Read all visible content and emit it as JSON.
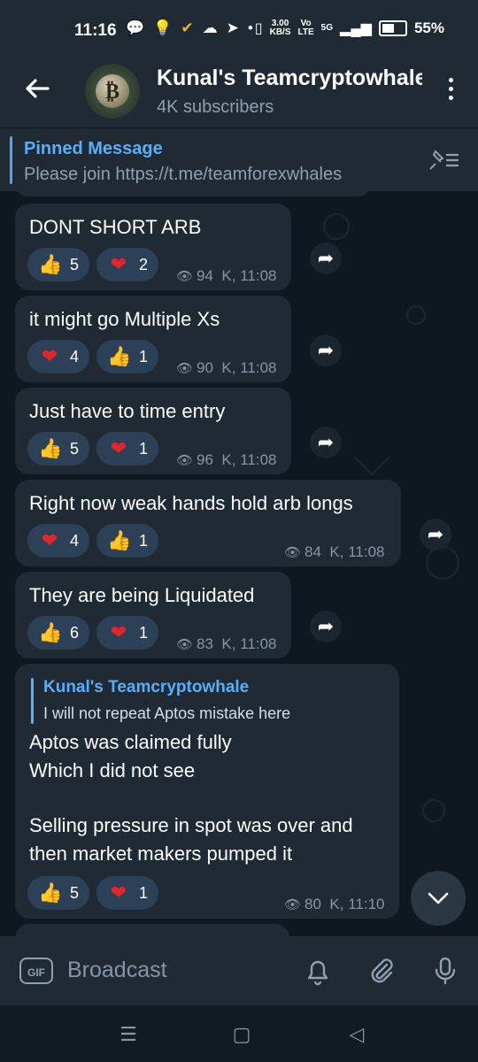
{
  "status_bar": {
    "time": "11:16",
    "speed_value": "3.00",
    "speed_unit": "KB/S",
    "network": "5G",
    "battery": "55%"
  },
  "header": {
    "channel_name": "Kunal's Teamcryptowhale",
    "subscribers": "4K subscribers"
  },
  "pinned": {
    "title": "Pinned Message",
    "text": "Please join   https://t.me/teamforexwhales"
  },
  "messages": [
    {
      "text": "DONT SHORT ARB",
      "reactions": [
        {
          "emoji": "👍",
          "count": "5"
        },
        {
          "emoji": "❤",
          "count": "2"
        }
      ],
      "views": "94",
      "time": "K, 11:08"
    },
    {
      "text": "it might go Multiple Xs",
      "reactions": [
        {
          "emoji": "❤",
          "count": "4"
        },
        {
          "emoji": "👍",
          "count": "1"
        }
      ],
      "views": "90",
      "time": "K, 11:08"
    },
    {
      "text": "Just have to time entry",
      "reactions": [
        {
          "emoji": "👍",
          "count": "5"
        },
        {
          "emoji": "❤",
          "count": "1"
        }
      ],
      "views": "96",
      "time": "K, 11:08"
    },
    {
      "text": "Right now weak hands hold arb longs",
      "reactions": [
        {
          "emoji": "❤",
          "count": "4"
        },
        {
          "emoji": "👍",
          "count": "1"
        }
      ],
      "views": "84",
      "time": "K, 11:08"
    },
    {
      "text": "They are being Liquidated",
      "reactions": [
        {
          "emoji": "👍",
          "count": "6"
        },
        {
          "emoji": "❤",
          "count": "1"
        }
      ],
      "views": "83",
      "time": "K, 11:08"
    },
    {
      "quote_name": "Kunal's Teamcryptowhale",
      "quote_text": "I will not repeat Aptos mistake here",
      "lines": [
        "Aptos was claimed fully",
        "Which I did not see",
        "Selling pressure in spot was over and",
        "then market makers pumped it"
      ],
      "reactions": [
        {
          "emoji": "👍",
          "count": "5"
        },
        {
          "emoji": "❤",
          "count": "1"
        }
      ],
      "views": "80",
      "time": "K, 11:10"
    }
  ],
  "composer": {
    "gif_label": "GIF",
    "placeholder": "Broadcast"
  },
  "icons": {
    "back": "back-arrow-icon",
    "menu": "more-vertical-icon",
    "unpin": "pinned-list-icon",
    "forward": "forward-arrow-icon",
    "views": "eye-icon",
    "scroll": "chevron-down-icon",
    "bell": "bell-icon",
    "attach": "paperclip-icon",
    "mic": "microphone-icon"
  }
}
